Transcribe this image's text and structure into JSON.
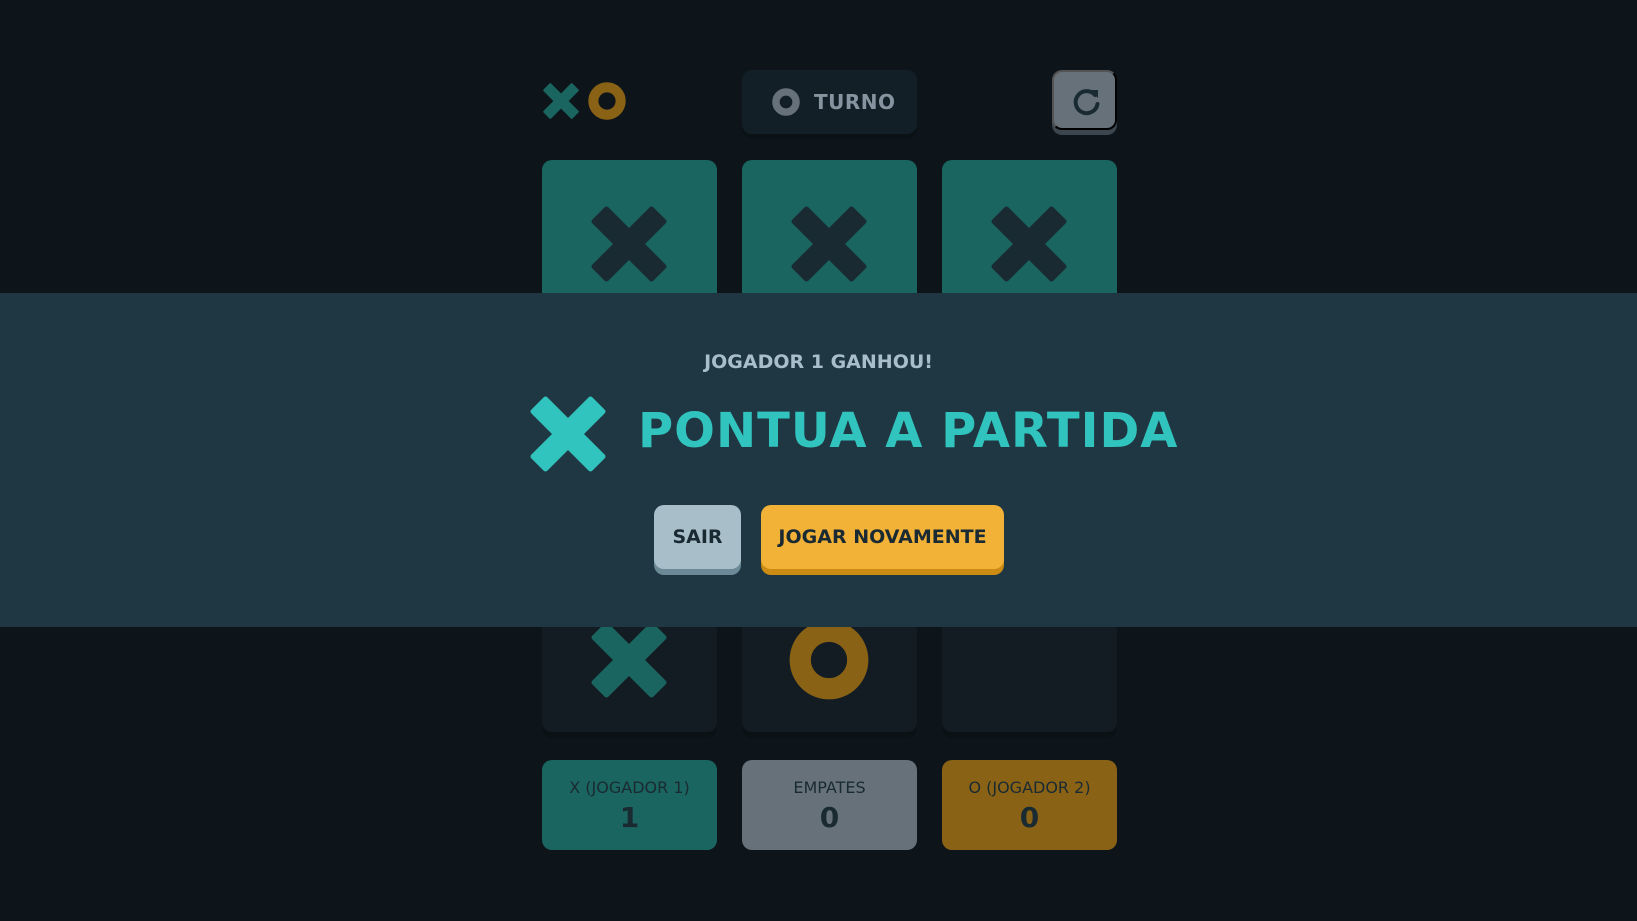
{
  "header": {
    "logo_icons": [
      "x-mark-icon",
      "o-mark-icon"
    ],
    "turn_icon": "o-mark-icon",
    "turn_label": "TURNO",
    "restart_icon": "restart-icon"
  },
  "board": {
    "cells": [
      "X",
      "X",
      "X",
      "",
      "",
      "",
      "X",
      "O",
      ""
    ],
    "winning_cells": [
      0,
      1,
      2
    ]
  },
  "overlay": {
    "subtitle": "JOGADOR 1 GANHOU!",
    "winner_icon": "x-mark-icon",
    "title": "PONTUA A PARTIDA",
    "quit_label": "SAIR",
    "next_label": "JOGAR NOVAMENTE"
  },
  "scores": {
    "x": {
      "label": "X (JOGADOR 1)",
      "value": "1"
    },
    "ties": {
      "label": "EMPATES",
      "value": "0"
    },
    "o": {
      "label": "O (JOGADOR 2)",
      "value": "0"
    }
  },
  "colors": {
    "background": "#0d151a",
    "x_color": "#31c3bd",
    "o_color": "#f2b137",
    "dim_x": "#1a6560",
    "dim_o": "#8a6216",
    "overlay": "#1f3743"
  }
}
